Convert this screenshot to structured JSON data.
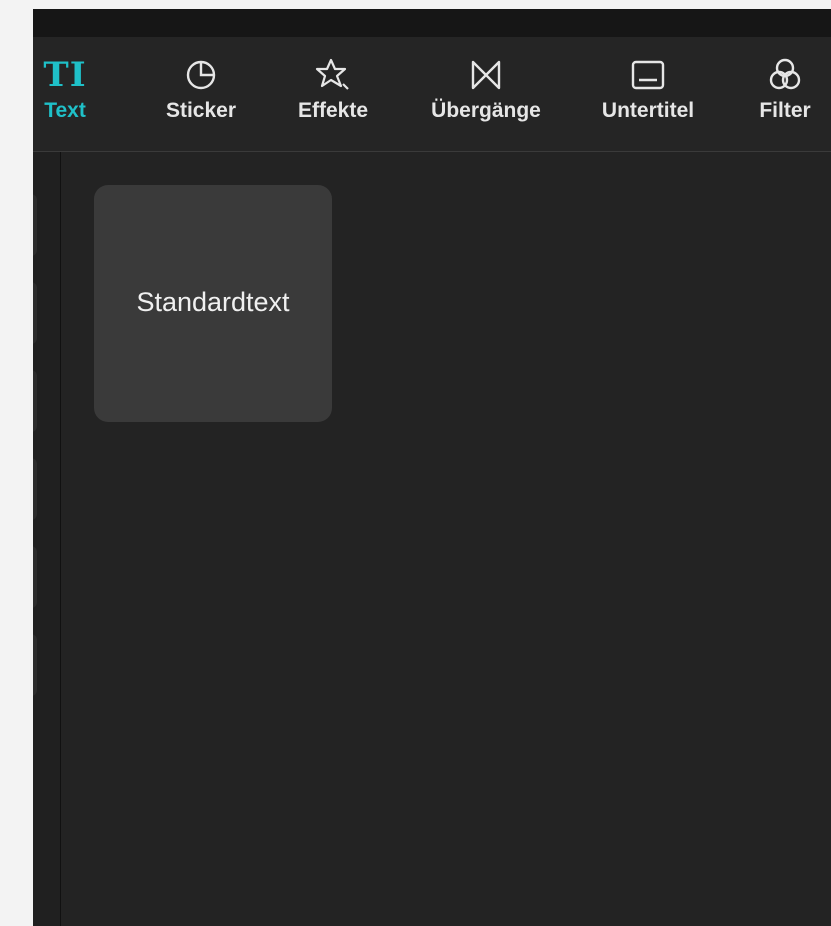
{
  "toolbar": {
    "items": [
      {
        "label": "Text",
        "icon": "text-ti-icon",
        "active": true
      },
      {
        "label": "Sticker",
        "icon": "sticker-icon"
      },
      {
        "label": "Effekte",
        "icon": "effects-star-icon"
      },
      {
        "label": "Übergänge",
        "icon": "transitions-bowtie-icon"
      },
      {
        "label": "Untertitel",
        "icon": "subtitles-icon"
      },
      {
        "label": "Filter",
        "icon": "filter-icon"
      }
    ],
    "text_glyph": "TI"
  },
  "content": {
    "cards": [
      {
        "label": "Standardtext"
      }
    ]
  },
  "colors": {
    "accent": "#1fc0c8",
    "panel_bg": "#232323",
    "card_bg": "#3a3a3a",
    "label": "#e6e6e6"
  }
}
